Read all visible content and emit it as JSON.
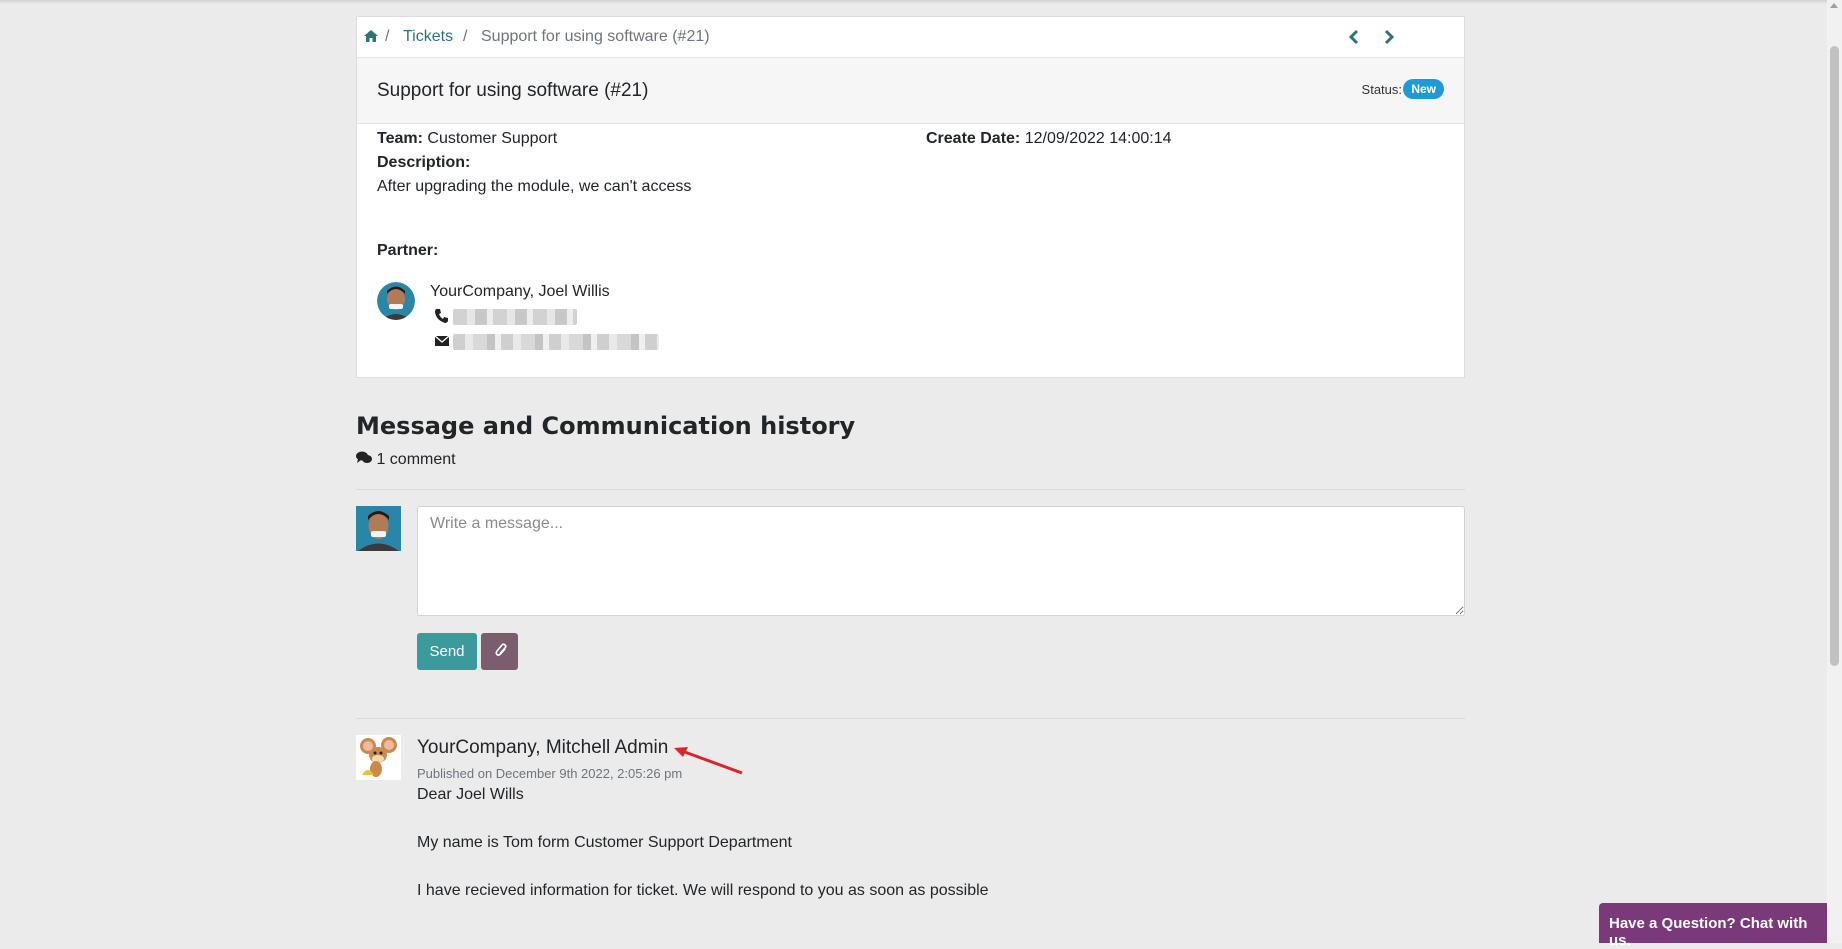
{
  "breadcrumb": {
    "home_icon": "home-icon",
    "tickets_link": "Tickets",
    "separator": "/",
    "current": "Support for using software (#21)",
    "prev_icon": "chevron-left-icon",
    "next_icon": "chevron-right-icon"
  },
  "ticket": {
    "title": "Support for using software (#21)",
    "status_label": "Status:",
    "status": "New",
    "team_label": "Team:",
    "team": "Customer Support",
    "create_date_label": "Create Date:",
    "create_date": "12/09/2022 14:00:14",
    "description_label": "Description:",
    "description": "After upgrading the module, we can't access",
    "partner_label": "Partner:",
    "partner_name": "YourCompany, Joel Willis",
    "phone_icon": "phone-icon",
    "email_icon": "envelope-icon"
  },
  "history": {
    "heading": "Message and Communication history",
    "comments_icon": "comments-icon",
    "comment_count": "1 comment",
    "message_placeholder": "Write a message...",
    "send_label": "Send",
    "attach_icon": "paperclip-icon"
  },
  "message": {
    "author": "YourCompany, Mitchell Admin",
    "published": "Published on December 9th 2022, 2:05:26 pm",
    "line1": "Dear Joel Wills",
    "line2": "My name is Tom form Customer Support Department",
    "line3": "I have recieved information for ticket. We will respond to you as soon as possible"
  },
  "chat": {
    "label": "Have a Question? Chat with us."
  },
  "colors": {
    "accent": "#2b7575",
    "badge": "#1e9ad6",
    "send": "#3a9a9c",
    "chat": "#7a3a7a",
    "arrow": "#d8262c"
  }
}
